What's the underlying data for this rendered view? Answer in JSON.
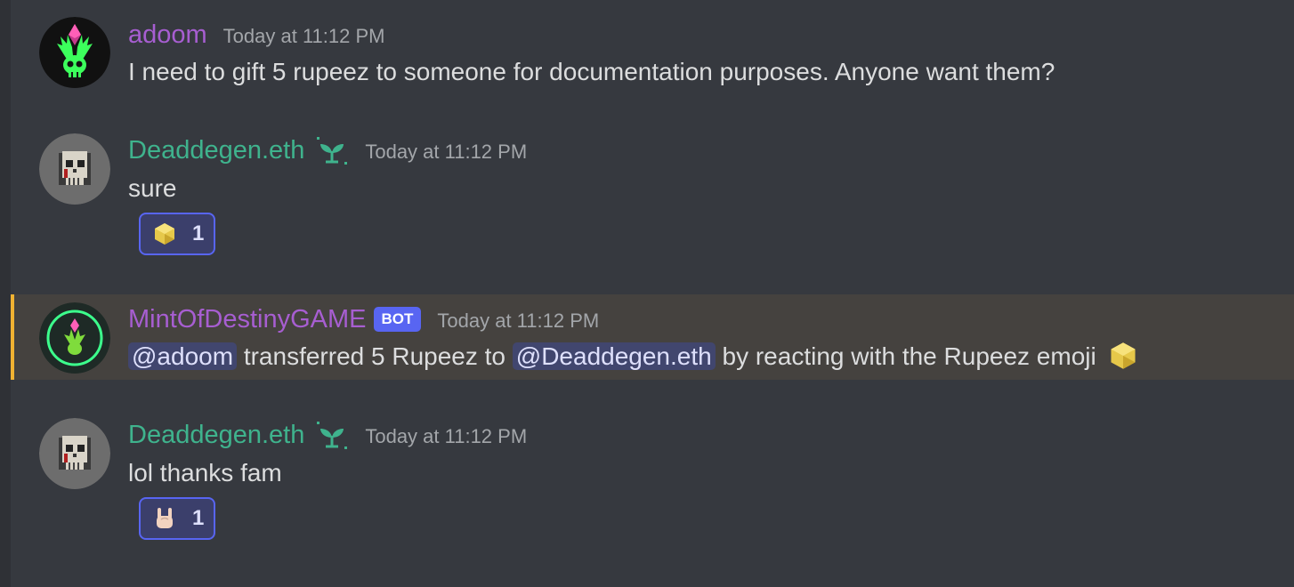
{
  "messages": [
    {
      "author": "adoom",
      "author_color": "#a75ed1",
      "timestamp": "Today at 11:12 PM",
      "text": "I need to gift 5 rupeez to someone for documentation purposes. Anyone want them?"
    },
    {
      "author": "Deaddegen.eth",
      "author_color": "#3fb38d",
      "timestamp": "Today at 11:12 PM",
      "text": "sure",
      "reaction": {
        "emoji": "rupeez-gem-icon",
        "count": "1"
      }
    },
    {
      "author": "MintOfDestinyGAME",
      "author_color": "#a75ed1",
      "bot_tag": "BOT",
      "timestamp": "Today at 11:12 PM",
      "mention_from": "@adoom",
      "text_middle": "transferred 5 Rupeez to",
      "mention_to": "@Deaddegen.eth",
      "text_end": "by reacting with the Rupeez emoji",
      "highlight_color": "#f0b232"
    },
    {
      "author": "Deaddegen.eth",
      "author_color": "#3fb38d",
      "timestamp": "Today at 11:12 PM",
      "text": "lol thanks fam",
      "reaction": {
        "emoji": "rock-on-hand-icon",
        "count": "1"
      }
    }
  ]
}
